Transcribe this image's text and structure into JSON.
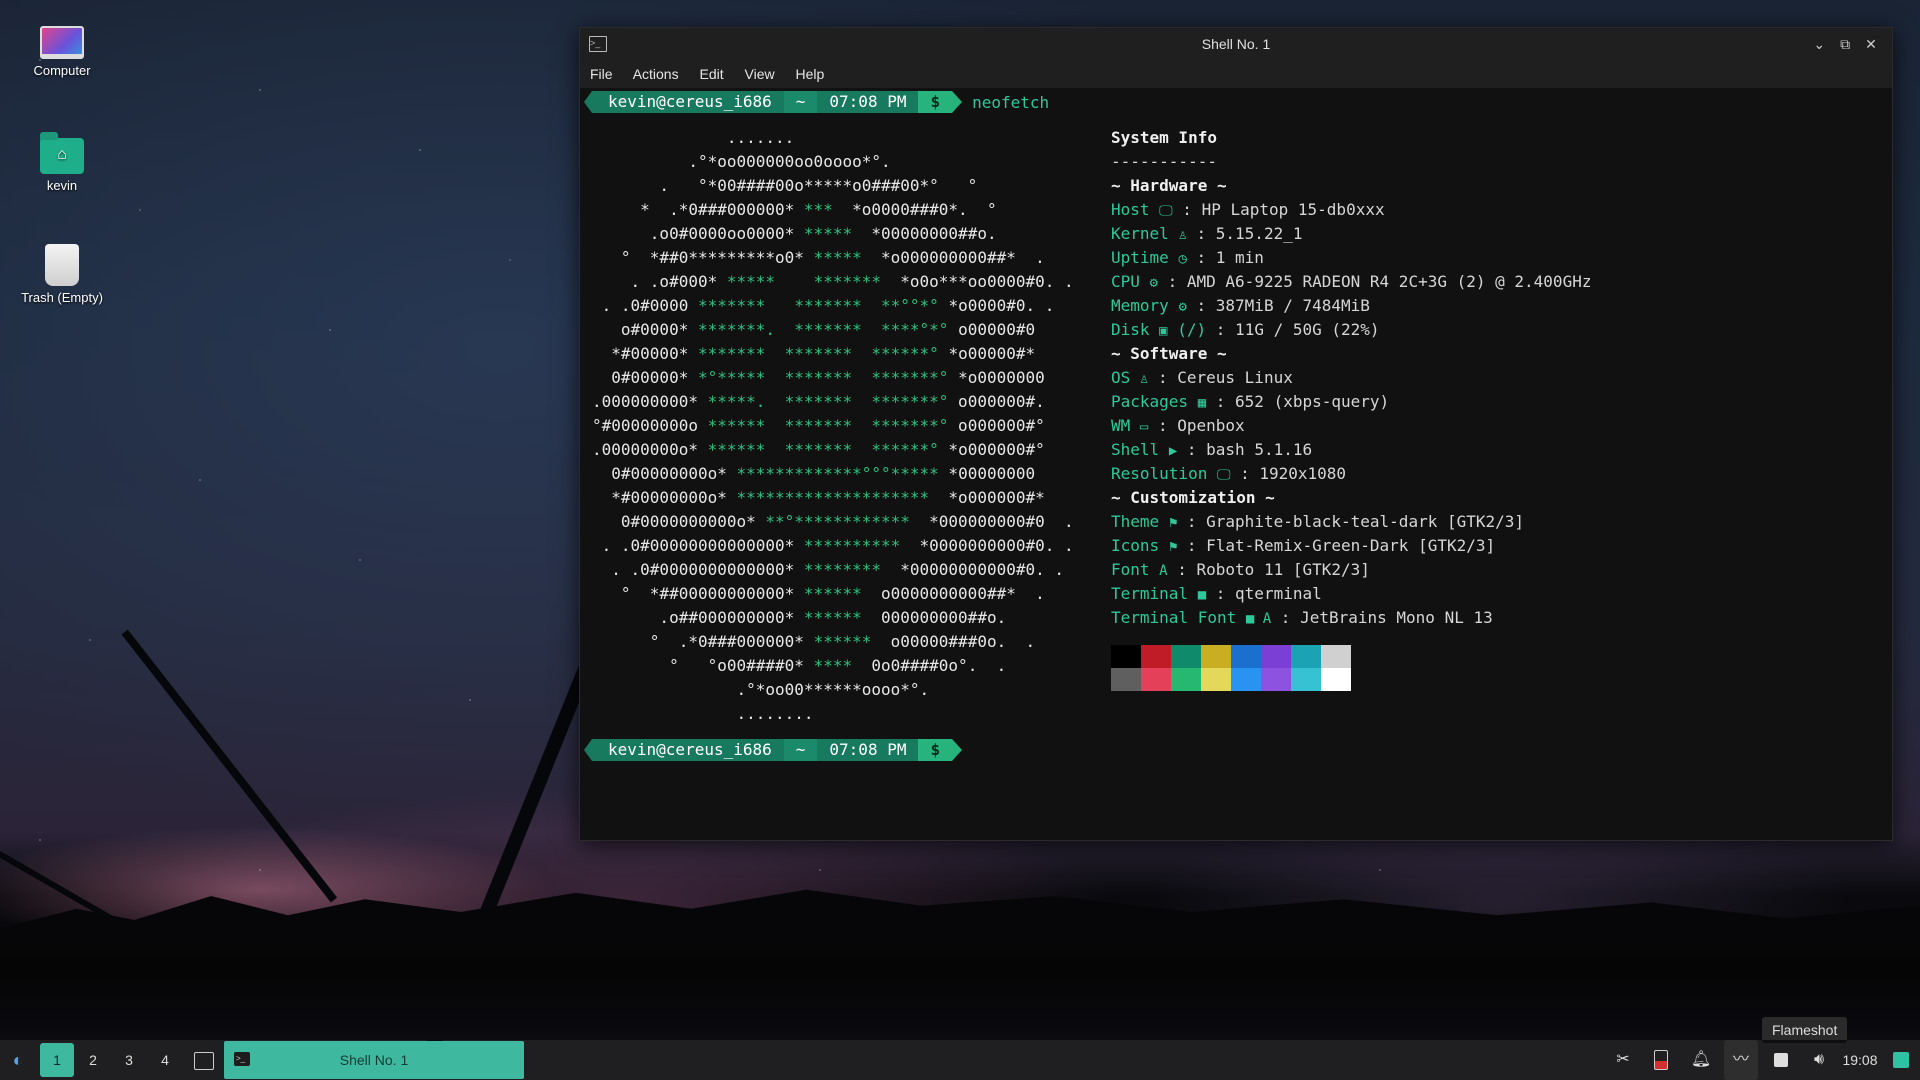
{
  "desktop": {
    "icons": [
      {
        "label": "Computer"
      },
      {
        "label": "kevin"
      },
      {
        "label": "Trash (Empty)"
      }
    ]
  },
  "window": {
    "title": "Shell No. 1",
    "menu": [
      "File",
      "Actions",
      "Edit",
      "View",
      "Help"
    ],
    "controls": {
      "minimize": "⌄",
      "maximize": "⧉",
      "close": "✕"
    }
  },
  "terminal": {
    "prompt": {
      "user": "kevin@cereus_i686",
      "dir": "~",
      "time": "07:08 PM",
      "symbol": "$"
    },
    "command": "neofetch",
    "ascii_lines": [
      [
        [
          "w",
          "              ......."
        ]
      ],
      [
        [
          "w",
          "          .°*oo000000oo0oooo*°."
        ]
      ],
      [
        [
          "w",
          "       .   °*00####00o*****o0###00*°   °"
        ]
      ],
      [
        [
          "w",
          "     *  .*0###000000* "
        ],
        [
          "g",
          "***"
        ],
        [
          "w",
          "  *o0000###0*.  °"
        ]
      ],
      [
        [
          "w",
          "      .o0#0000oo0000* "
        ],
        [
          "g",
          "*****"
        ],
        [
          "w",
          "  *00000000##o."
        ]
      ],
      [
        [
          "w",
          "   °  *##0*********o0* "
        ],
        [
          "g",
          "*****"
        ],
        [
          "w",
          "  *o000000000##*  ."
        ]
      ],
      [
        [
          "w",
          "    . .o#000* "
        ],
        [
          "g",
          "*****"
        ],
        [
          "w",
          "    "
        ],
        [
          "g",
          "*******"
        ],
        [
          "w",
          "  *o0o***oo0000#0. ."
        ]
      ],
      [
        [
          "w",
          " . .0#0000 "
        ],
        [
          "g",
          "*******"
        ],
        [
          "w",
          "   "
        ],
        [
          "g",
          "*******"
        ],
        [
          "w",
          "  "
        ],
        [
          "g",
          "**°°*°"
        ],
        [
          "w",
          " *o0000#0. ."
        ]
      ],
      [
        [
          "w",
          "   o#0000* "
        ],
        [
          "g",
          "*******."
        ],
        [
          "w",
          "  "
        ],
        [
          "g",
          "*******"
        ],
        [
          "w",
          "  "
        ],
        [
          "g",
          "****°*°"
        ],
        [
          "w",
          " o00000#0"
        ]
      ],
      [
        [
          "w",
          "  *#00000* "
        ],
        [
          "g",
          "*******"
        ],
        [
          "w",
          "  "
        ],
        [
          "g",
          "*******"
        ],
        [
          "w",
          "  "
        ],
        [
          "g",
          "******°"
        ],
        [
          "w",
          " *o00000#*"
        ]
      ],
      [
        [
          "w",
          "  0#00000* "
        ],
        [
          "g",
          "*°*****"
        ],
        [
          "w",
          "  "
        ],
        [
          "g",
          "*******"
        ],
        [
          "w",
          "  "
        ],
        [
          "g",
          "*******°"
        ],
        [
          "w",
          " *o0000000"
        ]
      ],
      [
        [
          "w",
          ".000000000* "
        ],
        [
          "g",
          "*****."
        ],
        [
          "w",
          "  "
        ],
        [
          "g",
          "*******"
        ],
        [
          "w",
          "  "
        ],
        [
          "g",
          "*******°"
        ],
        [
          "w",
          " o000000#."
        ]
      ],
      [
        [
          "w",
          "°#00000000o "
        ],
        [
          "g",
          "******"
        ],
        [
          "w",
          "  "
        ],
        [
          "g",
          "*******"
        ],
        [
          "w",
          "  "
        ],
        [
          "g",
          "*******°"
        ],
        [
          "w",
          " o000000#°"
        ]
      ],
      [
        [
          "w",
          ".00000000o* "
        ],
        [
          "g",
          "******"
        ],
        [
          "w",
          "  "
        ],
        [
          "g",
          "*******"
        ],
        [
          "w",
          "  "
        ],
        [
          "g",
          "******°"
        ],
        [
          "w",
          " *o000000#°"
        ]
      ],
      [
        [
          "w",
          "  0#00000000o* "
        ],
        [
          "g",
          "*************°°°*****"
        ],
        [
          "w",
          " *00000000"
        ]
      ],
      [
        [
          "w",
          "  *#00000000o* "
        ],
        [
          "g",
          "********************"
        ],
        [
          "w",
          "  *o000000#*"
        ]
      ],
      [
        [
          "w",
          "   0#0000000000o* "
        ],
        [
          "g",
          "**°************"
        ],
        [
          "w",
          "  *000000000#0  ."
        ]
      ],
      [
        [
          "w",
          " . .0#00000000000000* "
        ],
        [
          "g",
          "**********"
        ],
        [
          "w",
          "  *0000000000#0. ."
        ]
      ],
      [
        [
          "w",
          "  . .0#0000000000000* "
        ],
        [
          "g",
          "********"
        ],
        [
          "w",
          "  *00000000000#0. ."
        ]
      ],
      [
        [
          "w",
          "   °  *##00000000000* "
        ],
        [
          "g",
          "******"
        ],
        [
          "w",
          "  o0000000000##*  ."
        ]
      ],
      [
        [
          "w",
          "       .o##000000000* "
        ],
        [
          "g",
          "******"
        ],
        [
          "w",
          "  000000000##o."
        ]
      ],
      [
        [
          "w",
          "      °  .*0###000000* "
        ],
        [
          "g",
          "******"
        ],
        [
          "w",
          "  o00000###0o.  ."
        ]
      ],
      [
        [
          "w",
          "        °   °o00####0* "
        ],
        [
          "g",
          "****"
        ],
        [
          "w",
          "  0o0####0o°.  ."
        ]
      ],
      [
        [
          "w",
          "               .°*oo00******oooo*°."
        ]
      ],
      [
        [
          "w",
          "               ........"
        ]
      ]
    ],
    "sysinfo": {
      "title": "System Info",
      "divider": "-----------",
      "sections": [
        {
          "header": "~ Hardware ~",
          "rows": [
            {
              "key": "Host",
              "icon": "monitor-icon",
              "glyph": "🖵",
              "value": ": HP Laptop 15-db0xxx"
            },
            {
              "key": "Kernel",
              "icon": "tux-icon",
              "glyph": "♙",
              "value": ": 5.15.22_1"
            },
            {
              "key": "Uptime",
              "icon": "clock-icon",
              "glyph": "◷",
              "value": ": 1 min"
            },
            {
              "key": "CPU",
              "icon": "chip-icon",
              "glyph": "⚙",
              "value": ": AMD A6-9225 RADEON R4 2C+3G (2) @ 2.400GHz"
            },
            {
              "key": "Memory",
              "icon": "memory-icon",
              "glyph": "⚙",
              "value": ": 387MiB / 7484MiB"
            },
            {
              "key": "Disk",
              "icon": "disk-icon",
              "glyph": "▣",
              "extra": "(/)",
              "value": ": 11G / 50G (22%)"
            }
          ]
        },
        {
          "header": "~ Software ~",
          "rows": [
            {
              "key": "OS",
              "icon": "tux-icon",
              "glyph": "♙",
              "value": ": Cereus Linux"
            },
            {
              "key": "Packages",
              "icon": "package-icon",
              "glyph": "▦",
              "value": ": 652 (xbps-query)"
            },
            {
              "key": "WM",
              "icon": "window-icon",
              "glyph": "▭",
              "value": ": Openbox"
            },
            {
              "key": "Shell",
              "icon": "terminal-icon",
              "glyph": "▶",
              "value": ": bash 5.1.16"
            },
            {
              "key": "Resolution",
              "icon": "monitor-icon",
              "glyph": "🖵",
              "value": ": 1920x1080"
            }
          ]
        },
        {
          "header": "~ Customization ~",
          "rows": [
            {
              "key": "Theme",
              "icon": "paint-roller-icon",
              "glyph": "⚑",
              "value": ": Graphite-black-teal-dark [GTK2/3]"
            },
            {
              "key": "Icons",
              "icon": "paint-roller-icon",
              "glyph": "⚑",
              "value": ": Flat-Remix-Green-Dark [GTK2/3]"
            },
            {
              "key": "Font",
              "icon": "font-icon",
              "glyph": "A",
              "value": ": Roboto 11 [GTK2/3]"
            },
            {
              "key": "Terminal",
              "icon": "terminal-icon",
              "glyph": "■",
              "value": ": qterminal"
            },
            {
              "key": "Terminal Font",
              "icon": "terminal-font-icon",
              "glyph": "■ A",
              "value": ": JetBrains Mono NL 13"
            }
          ]
        }
      ]
    },
    "palette": {
      "normal": [
        "#000000",
        "#c01c28",
        "#0f8a6a",
        "#c9ad23",
        "#1a6fcf",
        "#7b3fd6",
        "#1ba3b4",
        "#d0d0d0"
      ],
      "bright": [
        "#5f5f5f",
        "#e5405a",
        "#26b871",
        "#e4d85a",
        "#2a92f0",
        "#8e52e0",
        "#36c2d2",
        "#ffffff"
      ]
    }
  },
  "taskbar": {
    "launcher_icon": "void-launcher-icon",
    "workspaces": [
      "1",
      "2",
      "3",
      "4"
    ],
    "active_workspace": "1",
    "task": "Shell No. 1",
    "tooltip": "Flameshot",
    "clock": "19:08"
  }
}
